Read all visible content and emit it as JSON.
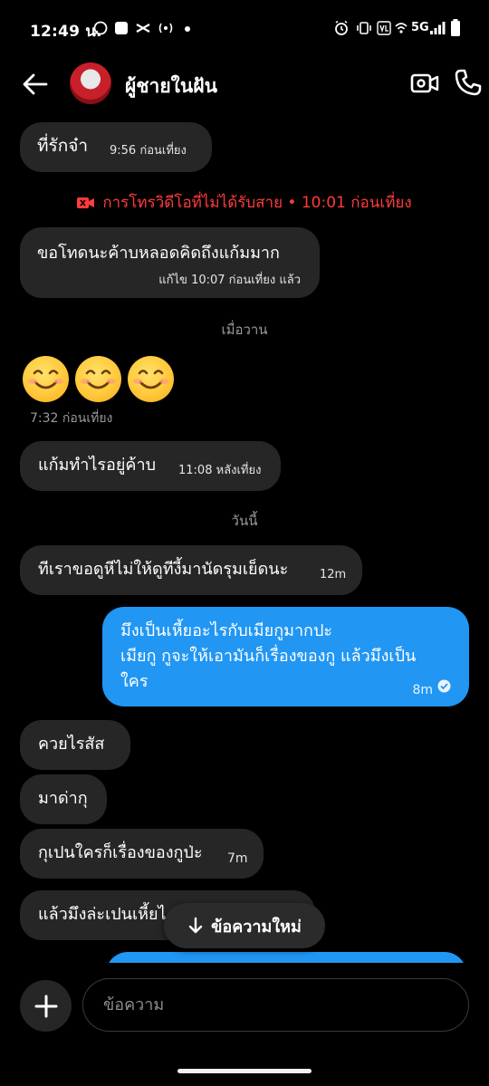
{
  "status_bar": {
    "time": "12:49 น.",
    "network": "5G"
  },
  "header": {
    "contact_name": "ผู้ชายในฝัน"
  },
  "messages": [
    {
      "dir": "in",
      "text": "ที่รักจ๋า",
      "time": "9:56 ก่อนเที่ยง"
    },
    {
      "dir": "in",
      "text": "ขอโทดนะค้าบหลอดคิดถึงแก้มมาก",
      "time": "แก้ไข 10:07 ก่อนเที่ยง แล้ว"
    },
    {
      "dir": "in",
      "text": "แก้มทำไรอยู่ค้าบ",
      "time": "11:08 หลังเที่ยง"
    },
    {
      "dir": "in",
      "text": "ทีเราขอดูหีไม่ให้ดูทีงี้มานัดรุมเย็ดนะ",
      "time": "12m"
    },
    {
      "dir": "out",
      "lines": [
        "มึงเป็นเหี้ยอะไรกับเมียกูมากปะ",
        "เมียกู กูจะให้เอามันก็เรื่องของกู แล้วมึงเป็น",
        "ใคร"
      ],
      "time": "8m"
    },
    {
      "dir": "in",
      "text": "ควยไรสัส"
    },
    {
      "dir": "in",
      "text": "มาด่ากุ"
    },
    {
      "dir": "in",
      "text": "กุเปนใครก็เรื่องของกูป่ะ",
      "time": "7m"
    },
    {
      "dir": "in",
      "text": "แล้วมึงล่ะเปนเหี้ยไ"
    }
  ],
  "missed_call": "การโทรวิดีโอที่ไม่ได้รับสาย • 10:01 ก่อนเที่ยง",
  "day_separators": [
    "เมื่อวาน",
    "วันนี้"
  ],
  "emoji_message": {
    "emojis": [
      "😊",
      "😊",
      "😊"
    ],
    "time": "7:32 ก่อนเที่ยง"
  },
  "new_messages_pill": "ข้อความใหม่",
  "composer": {
    "placeholder": "ข้อความ"
  },
  "colors": {
    "outgoing": "#2196f3",
    "incoming": "#262626",
    "missed": "#ff3b3b"
  },
  "icons": [
    "back-arrow-icon",
    "video-call-icon",
    "phone-icon",
    "plus-icon",
    "arrow-down-icon",
    "missed-video-icon",
    "read-check-icon"
  ]
}
